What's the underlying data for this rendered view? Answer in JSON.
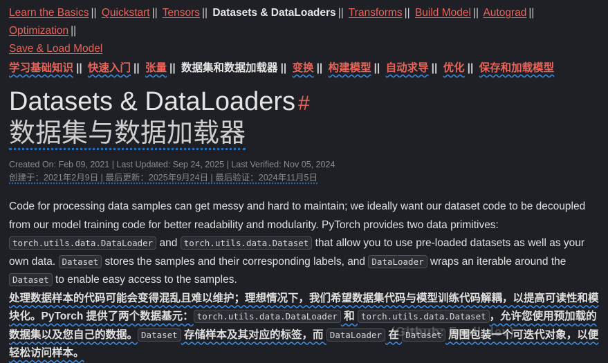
{
  "nav": {
    "items": [
      {
        "label": "Learn the Basics",
        "current": false
      },
      {
        "label": "Quickstart",
        "current": false
      },
      {
        "label": "Tensors",
        "current": false
      },
      {
        "label": "Datasets & DataLoaders",
        "current": true
      },
      {
        "label": "Transforms",
        "current": false
      },
      {
        "label": "Build Model",
        "current": false
      },
      {
        "label": "Autograd",
        "current": false
      },
      {
        "label": "Optimization",
        "current": false
      },
      {
        "label": "Save & Load Model",
        "current": false
      }
    ],
    "items_zh": [
      {
        "label": "学习基础知识",
        "current": false
      },
      {
        "label": "快速入门",
        "current": false
      },
      {
        "label": "张量",
        "current": false
      },
      {
        "label": "数据集和数据加载器",
        "current": true
      },
      {
        "label": "变换",
        "current": false
      },
      {
        "label": "构建模型",
        "current": false
      },
      {
        "label": "自动求导",
        "current": false
      },
      {
        "label": "优化",
        "current": false
      },
      {
        "label": "保存和加载模型",
        "current": false
      }
    ],
    "separator": "||"
  },
  "title": {
    "text": "Datasets & DataLoaders",
    "anchor": "#",
    "text_zh": "数据集与数据加载器"
  },
  "meta": {
    "en": "Created On: Feb 09, 2021 | Last Updated: Sep 24, 2025 | Last Verified: Nov 05, 2024",
    "zh": "创建于：2021年2月9日 | 最后更新：2025年9月24日 | 最后验证：2024年11月5日"
  },
  "para_en": {
    "t1": "Code for processing data samples can get messy and hard to maintain; we ideally want our dataset code to be decoupled from our model training code for better readability and modularity. PyTorch provides two data primitives: ",
    "c1": "torch.utils.data.DataLoader",
    "t2": " and ",
    "c2": "torch.utils.data.Dataset",
    "t3": " that allow you to use pre-loaded datasets as well as your own data. ",
    "c3": "Dataset",
    "t4": " stores the samples and their corresponding labels, and ",
    "c4": "DataLoader",
    "t5": " wraps an iterable around the ",
    "c5": "Dataset",
    "t6": " to enable easy access to the samples."
  },
  "para_zh": {
    "t1": "处理数据样本的代码可能会变得混乱且难以维护；理想情况下，我们希望数据集代码与模型训练代码解耦，以提高可读性和模块化。PyTorch 提供了两个数据基元：",
    "c1": "torch.utils.data.DataLoader",
    "t2": " 和 ",
    "c2": "torch.utils.data.Dataset",
    "t3": "，允许您使用预加载的数据集以及您自己的数据。",
    "c3": "Dataset",
    "t4": " 存储样本及其对应的标签，而 ",
    "c4": "DataLoader",
    "t5": " 在 ",
    "c5": "Dataset",
    "t6": " 周围包装一个可迭代对象，以便轻松访问样本。"
  },
  "watermark": "(Github: Fuall-dev)",
  "colors": {
    "background": "#1e2025",
    "link": "#e8645a",
    "underline_wavy": "#3a8ee6",
    "text": "#e0e0e0",
    "muted": "#8c8c8c"
  }
}
